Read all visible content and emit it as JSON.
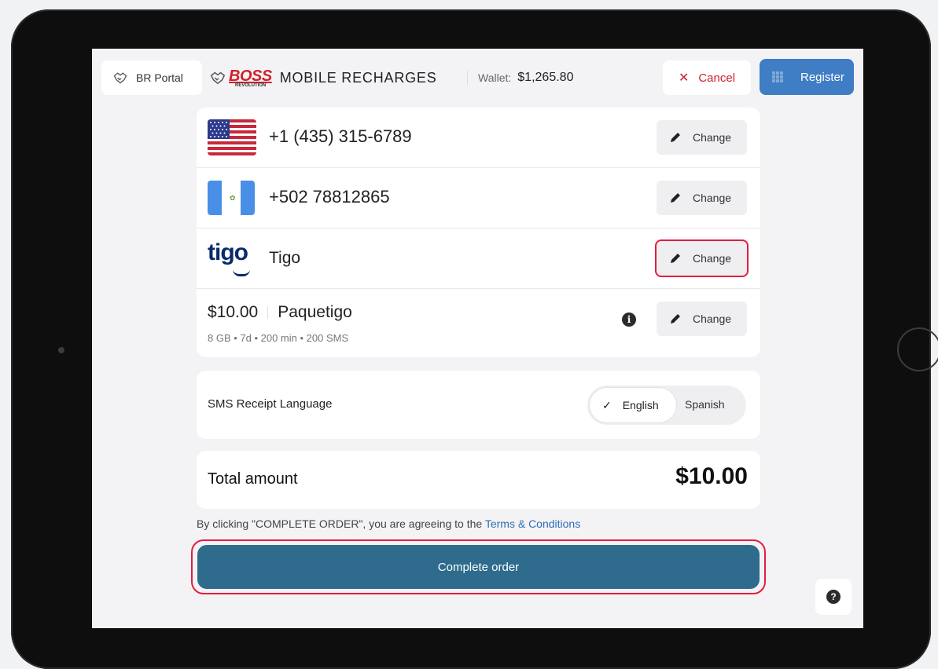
{
  "header": {
    "portal_label": "BR Portal",
    "brand_logo_text": "BOSS",
    "brand_logo_sub": "REVOLUTION",
    "title": "MOBILE RECHARGES",
    "wallet_label": "Wallet:",
    "wallet_amount": "$1,265.80",
    "cancel_label": "Cancel",
    "register_label": "Register"
  },
  "order": {
    "sender": {
      "phone": "+1 (435) 315-6789",
      "flag": "us-flag-icon",
      "change_label": "Change"
    },
    "recipient": {
      "phone": "+502 78812865",
      "flag": "guatemala-flag-icon",
      "change_label": "Change"
    },
    "carrier": {
      "logo_text": "tigo",
      "name": "Tigo",
      "change_label": "Change"
    },
    "plan": {
      "price": "$10.00",
      "name": "Paquetigo",
      "details": "8 GB • 7d • 200 min • 200 SMS",
      "info_glyph": "i",
      "change_label": "Change"
    }
  },
  "sms": {
    "label": "SMS Receipt Language",
    "options": [
      "English",
      "Spanish"
    ],
    "selected": "English"
  },
  "total": {
    "label": "Total amount",
    "amount": "$10.00"
  },
  "terms": {
    "text": "By clicking \"COMPLETE ORDER\", you are agreeing to the ",
    "link": "Terms & Conditions"
  },
  "complete_label": "Complete order",
  "help_glyph": "?",
  "colors": {
    "accent": "#2e6b8c",
    "register": "#3f7dc4",
    "danger": "#d11e2e",
    "highlight": "#e31d3f",
    "link": "#2f6fb3"
  }
}
